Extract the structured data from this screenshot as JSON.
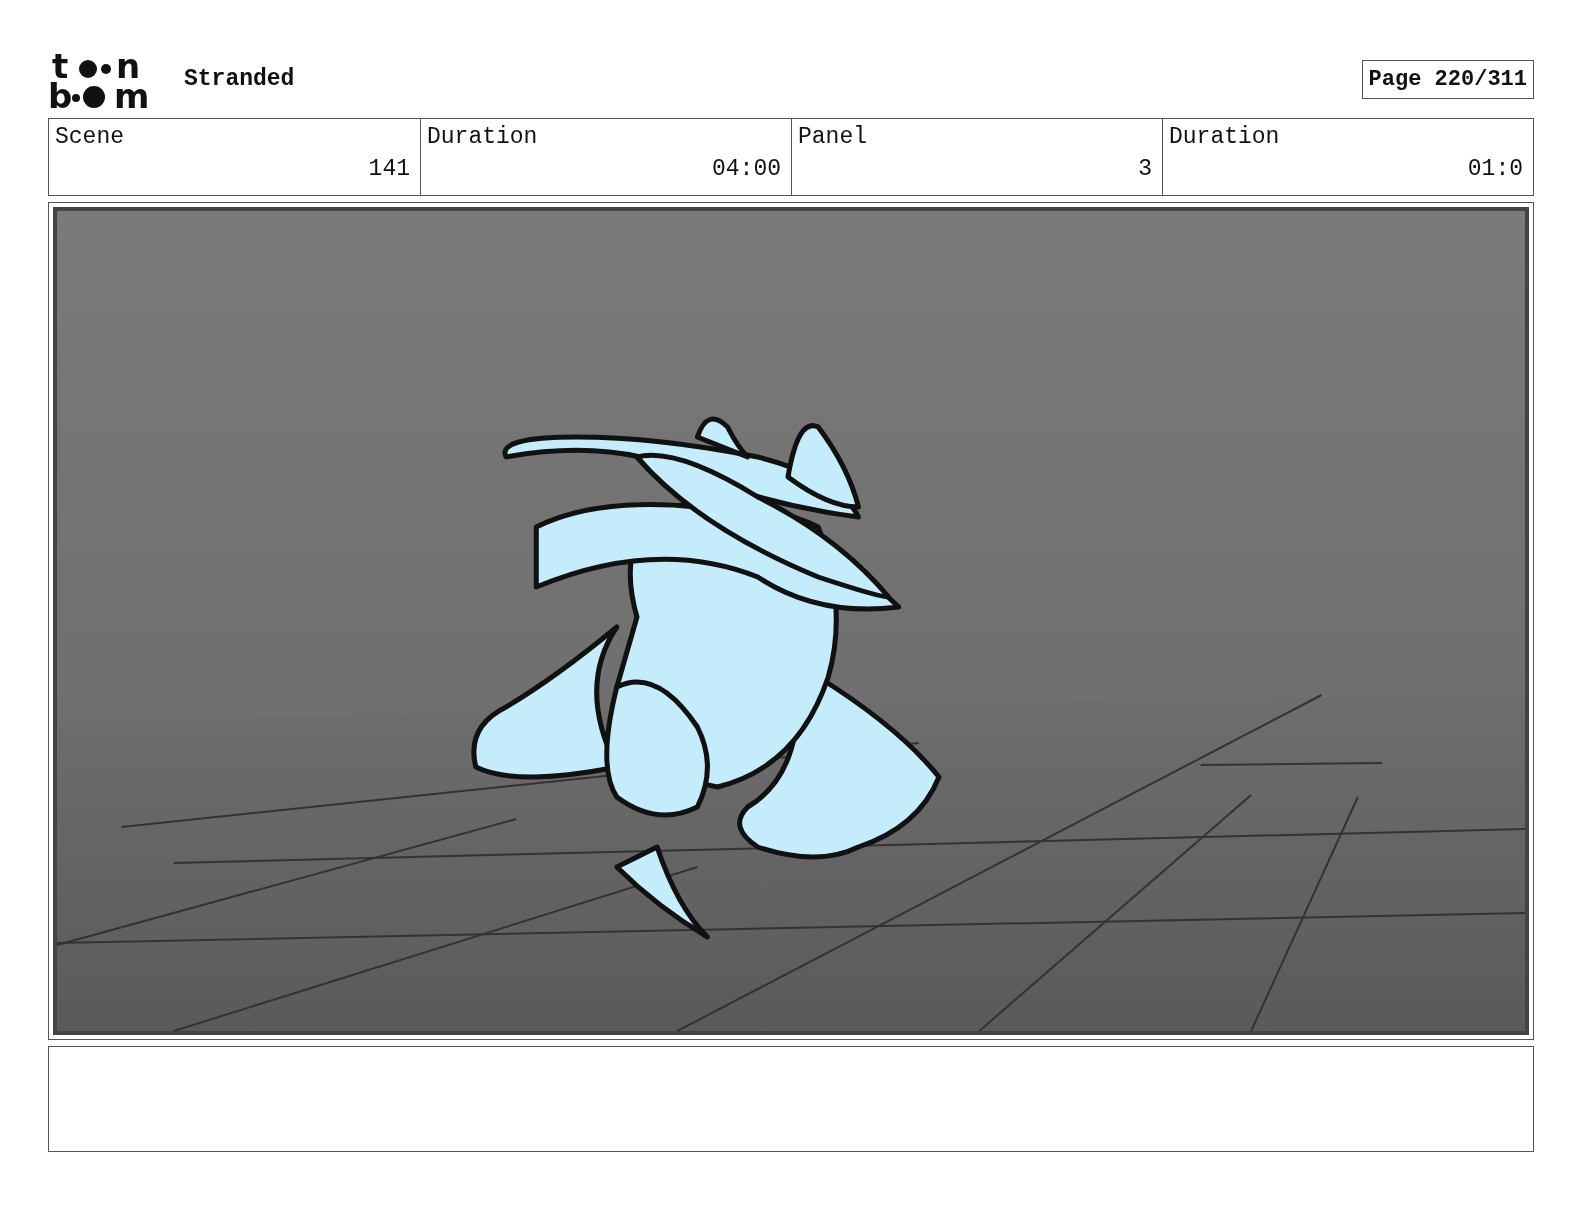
{
  "logo": {
    "top": [
      "t",
      "n"
    ],
    "bottom": [
      "b",
      "m"
    ]
  },
  "title": "Stranded",
  "page": "Page 220/311",
  "info_table": {
    "header_row": [
      "Scene",
      "Duration",
      "Panel",
      "Duration"
    ],
    "value_row": [
      "141",
      "04:00",
      "3",
      "01:0"
    ]
  }
}
